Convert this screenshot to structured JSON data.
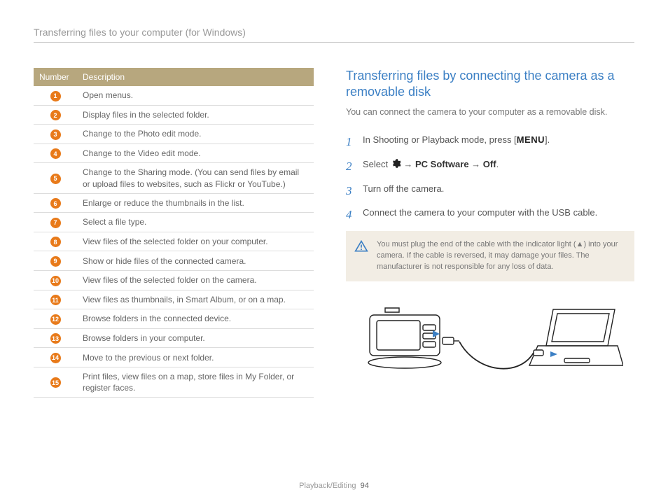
{
  "header": "Transferring files to your computer (for Windows)",
  "table": {
    "col_number": "Number",
    "col_description": "Description",
    "rows": [
      {
        "n": "1",
        "d": "Open menus."
      },
      {
        "n": "2",
        "d": "Display files in the selected folder."
      },
      {
        "n": "3",
        "d": "Change to the Photo edit mode."
      },
      {
        "n": "4",
        "d": "Change to the Video edit mode."
      },
      {
        "n": "5",
        "d": "Change to the Sharing mode. (You can send files by email or upload files to websites, such as Flickr or YouTube.)"
      },
      {
        "n": "6",
        "d": "Enlarge or reduce the thumbnails in the list."
      },
      {
        "n": "7",
        "d": "Select a file type."
      },
      {
        "n": "8",
        "d": "View files of the selected folder on your computer."
      },
      {
        "n": "9",
        "d": "Show or hide files of the connected camera."
      },
      {
        "n": "10",
        "d": "View files of the selected folder on the camera."
      },
      {
        "n": "11",
        "d": "View files as thumbnails, in Smart Album, or on a map."
      },
      {
        "n": "12",
        "d": "Browse folders in the connected device."
      },
      {
        "n": "13",
        "d": "Browse folders in your computer."
      },
      {
        "n": "14",
        "d": "Move to the previous or next folder."
      },
      {
        "n": "15",
        "d": "Print files, view files on a map, store files in My Folder, or register faces."
      }
    ]
  },
  "section": {
    "heading": "Transferring files by connecting the camera as a removable disk",
    "sub": "You can connect the camera to your computer as a removable disk.",
    "steps": {
      "s1_a": "In Shooting or Playback mode, press [",
      "s1_menu": "MENU",
      "s1_b": "].",
      "s2_a": "Select ",
      "s2_arrow1": " → ",
      "s2_pc": "PC Software",
      "s2_arrow2": " → ",
      "s2_off": "Off",
      "s2_period": ".",
      "s3": "Turn off the camera.",
      "s4": "Connect the camera to your computer with the USB cable."
    },
    "warning_a": "You must plug the end of the cable with the indicator light (",
    "warning_tri": "▲",
    "warning_b": ") into your camera. If the cable is reversed, it may damage your files. The manufacturer is not responsible for any loss of data."
  },
  "footer": {
    "section": "Playback/Editing",
    "page": "94"
  }
}
